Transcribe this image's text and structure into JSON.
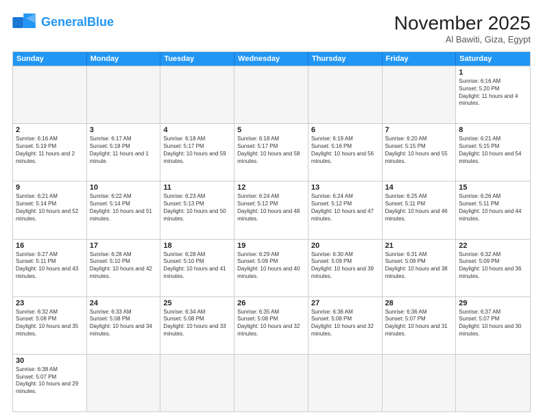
{
  "header": {
    "logo_general": "General",
    "logo_blue": "Blue",
    "month_title": "November 2025",
    "location": "Al Bawiti, Giza, Egypt"
  },
  "weekdays": [
    "Sunday",
    "Monday",
    "Tuesday",
    "Wednesday",
    "Thursday",
    "Friday",
    "Saturday"
  ],
  "rows": [
    [
      {
        "day": "",
        "text": ""
      },
      {
        "day": "",
        "text": ""
      },
      {
        "day": "",
        "text": ""
      },
      {
        "day": "",
        "text": ""
      },
      {
        "day": "",
        "text": ""
      },
      {
        "day": "",
        "text": ""
      },
      {
        "day": "1",
        "text": "Sunrise: 6:16 AM\nSunset: 5:20 PM\nDaylight: 11 hours and 4 minutes."
      }
    ],
    [
      {
        "day": "2",
        "text": "Sunrise: 6:16 AM\nSunset: 5:19 PM\nDaylight: 11 hours and 2 minutes."
      },
      {
        "day": "3",
        "text": "Sunrise: 6:17 AM\nSunset: 5:18 PM\nDaylight: 11 hours and 1 minute."
      },
      {
        "day": "4",
        "text": "Sunrise: 6:18 AM\nSunset: 5:17 PM\nDaylight: 10 hours and 59 minutes."
      },
      {
        "day": "5",
        "text": "Sunrise: 6:18 AM\nSunset: 5:17 PM\nDaylight: 10 hours and 58 minutes."
      },
      {
        "day": "6",
        "text": "Sunrise: 6:19 AM\nSunset: 5:16 PM\nDaylight: 10 hours and 56 minutes."
      },
      {
        "day": "7",
        "text": "Sunrise: 6:20 AM\nSunset: 5:15 PM\nDaylight: 10 hours and 55 minutes."
      },
      {
        "day": "8",
        "text": "Sunrise: 6:21 AM\nSunset: 5:15 PM\nDaylight: 10 hours and 54 minutes."
      }
    ],
    [
      {
        "day": "9",
        "text": "Sunrise: 6:21 AM\nSunset: 5:14 PM\nDaylight: 10 hours and 52 minutes."
      },
      {
        "day": "10",
        "text": "Sunrise: 6:22 AM\nSunset: 5:14 PM\nDaylight: 10 hours and 51 minutes."
      },
      {
        "day": "11",
        "text": "Sunrise: 6:23 AM\nSunset: 5:13 PM\nDaylight: 10 hours and 50 minutes."
      },
      {
        "day": "12",
        "text": "Sunrise: 6:24 AM\nSunset: 5:12 PM\nDaylight: 10 hours and 48 minutes."
      },
      {
        "day": "13",
        "text": "Sunrise: 6:24 AM\nSunset: 5:12 PM\nDaylight: 10 hours and 47 minutes."
      },
      {
        "day": "14",
        "text": "Sunrise: 6:25 AM\nSunset: 5:11 PM\nDaylight: 10 hours and 46 minutes."
      },
      {
        "day": "15",
        "text": "Sunrise: 6:26 AM\nSunset: 5:11 PM\nDaylight: 10 hours and 44 minutes."
      }
    ],
    [
      {
        "day": "16",
        "text": "Sunrise: 6:27 AM\nSunset: 5:11 PM\nDaylight: 10 hours and 43 minutes."
      },
      {
        "day": "17",
        "text": "Sunrise: 6:28 AM\nSunset: 5:10 PM\nDaylight: 10 hours and 42 minutes."
      },
      {
        "day": "18",
        "text": "Sunrise: 6:28 AM\nSunset: 5:10 PM\nDaylight: 10 hours and 41 minutes."
      },
      {
        "day": "19",
        "text": "Sunrise: 6:29 AM\nSunset: 5:09 PM\nDaylight: 10 hours and 40 minutes."
      },
      {
        "day": "20",
        "text": "Sunrise: 6:30 AM\nSunset: 5:09 PM\nDaylight: 10 hours and 39 minutes."
      },
      {
        "day": "21",
        "text": "Sunrise: 6:31 AM\nSunset: 5:09 PM\nDaylight: 10 hours and 38 minutes."
      },
      {
        "day": "22",
        "text": "Sunrise: 6:32 AM\nSunset: 5:09 PM\nDaylight: 10 hours and 36 minutes."
      }
    ],
    [
      {
        "day": "23",
        "text": "Sunrise: 6:32 AM\nSunset: 5:08 PM\nDaylight: 10 hours and 35 minutes."
      },
      {
        "day": "24",
        "text": "Sunrise: 6:33 AM\nSunset: 5:08 PM\nDaylight: 10 hours and 34 minutes."
      },
      {
        "day": "25",
        "text": "Sunrise: 6:34 AM\nSunset: 5:08 PM\nDaylight: 10 hours and 33 minutes."
      },
      {
        "day": "26",
        "text": "Sunrise: 6:35 AM\nSunset: 5:08 PM\nDaylight: 10 hours and 32 minutes."
      },
      {
        "day": "27",
        "text": "Sunrise: 6:36 AM\nSunset: 5:08 PM\nDaylight: 10 hours and 32 minutes."
      },
      {
        "day": "28",
        "text": "Sunrise: 6:36 AM\nSunset: 5:07 PM\nDaylight: 10 hours and 31 minutes."
      },
      {
        "day": "29",
        "text": "Sunrise: 6:37 AM\nSunset: 5:07 PM\nDaylight: 10 hours and 30 minutes."
      }
    ],
    [
      {
        "day": "30",
        "text": "Sunrise: 6:38 AM\nSunset: 5:07 PM\nDaylight: 10 hours and 29 minutes."
      },
      {
        "day": "",
        "text": ""
      },
      {
        "day": "",
        "text": ""
      },
      {
        "day": "",
        "text": ""
      },
      {
        "day": "",
        "text": ""
      },
      {
        "day": "",
        "text": ""
      },
      {
        "day": "",
        "text": ""
      }
    ]
  ]
}
